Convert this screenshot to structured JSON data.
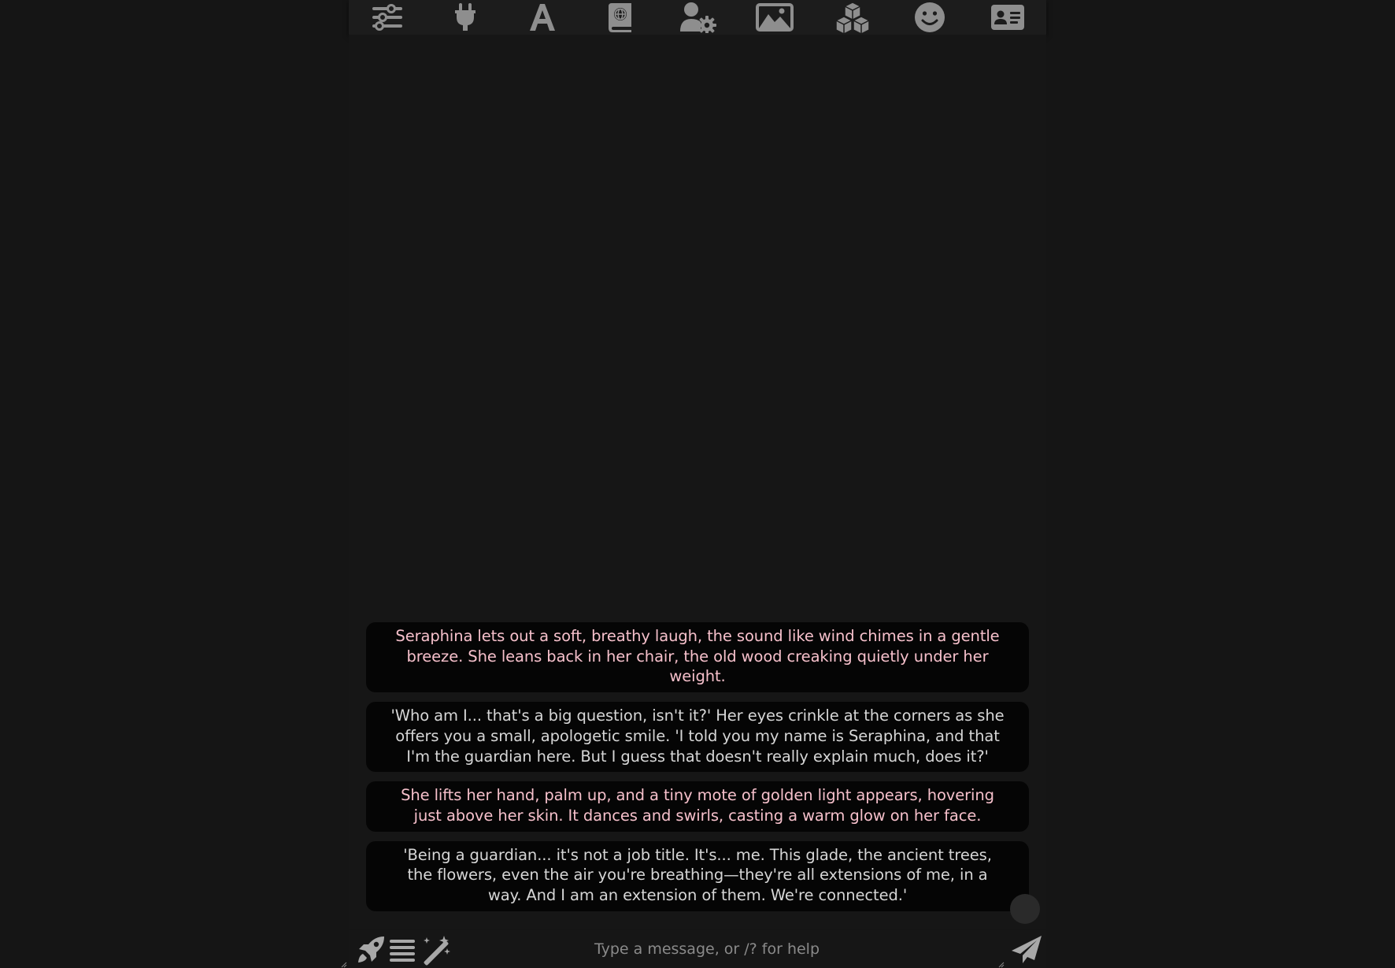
{
  "toolbar": {
    "items": [
      {
        "icon": "sliders-icon"
      },
      {
        "icon": "plug-icon"
      },
      {
        "icon": "font-a-icon"
      },
      {
        "icon": "globe-book-icon"
      },
      {
        "icon": "user-gear-icon"
      },
      {
        "icon": "image-landscape-icon"
      },
      {
        "icon": "cubes-icon"
      },
      {
        "icon": "smiley-icon"
      },
      {
        "icon": "id-card-icon"
      }
    ],
    "icon_color": "#8e8e8e"
  },
  "chat": {
    "messages": [
      {
        "type": "narration",
        "text": "Seraphina lets out a soft, breathy laugh, the sound like wind chimes in a gentle breeze. She leans back in her chair, the old wood creaking quietly under her weight."
      },
      {
        "type": "dialogue",
        "text": "'Who am I... that's a big question, isn't it?' Her eyes crinkle at the corners as she offers you a small, apologetic smile. 'I told you my name is Seraphina, and that I'm the guardian here. But I guess that doesn't really explain much, does it?'"
      },
      {
        "type": "narration",
        "text": "She lifts her hand, palm up, and a tiny mote of golden light appears, hovering just above her skin. It dances and swirls, casting a warm glow on her face."
      },
      {
        "type": "dialogue",
        "text": "'Being a guardian... it's not a job title. It's... me. This glade, the ancient trees, the flowers, even the air you're breathing—they're all extensions of me, in a way. And I am an extension of them. We're connected.'"
      }
    ],
    "colors": {
      "narration": "#f6c0cb",
      "dialogue": "#d6d6d6",
      "bubble_bg": "#050505",
      "page_bg": "#151515"
    }
  },
  "input": {
    "placeholder": "Type a message, or /? for help",
    "value": "",
    "left_icons": [
      "rocket-icon",
      "menu-lines-icon",
      "magic-wand-icon"
    ],
    "send_icon": "paper-plane-icon"
  }
}
